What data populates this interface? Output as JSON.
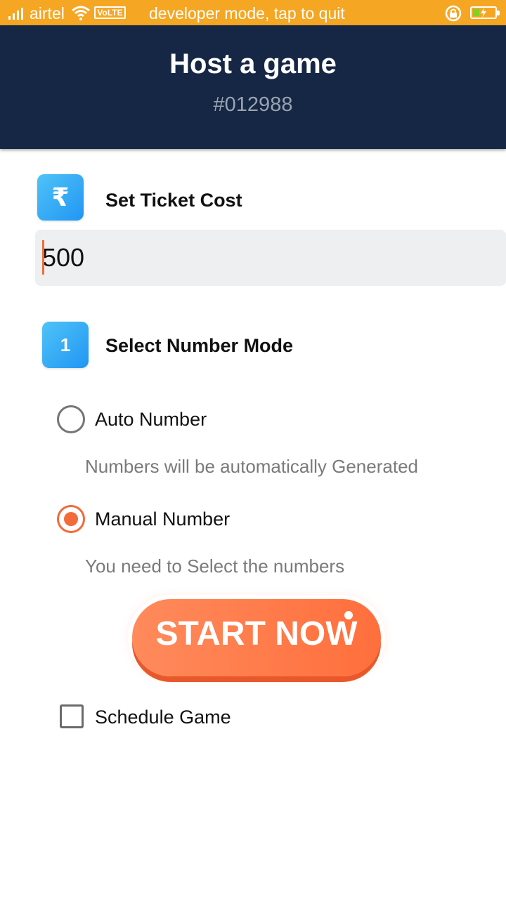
{
  "status_bar": {
    "carrier": "airtel",
    "volte": "VoLTE",
    "message": "developer mode, tap to quit",
    "battery_color": "#7ED321"
  },
  "header": {
    "title": "Host a game",
    "game_id": "#012988",
    "background": "#152744"
  },
  "ticket_cost": {
    "icon": "₹",
    "title": "Set Ticket Cost",
    "value": "500"
  },
  "number_mode": {
    "step": "1",
    "title": "Select Number Mode",
    "options": [
      {
        "label": "Auto Number",
        "description": "Numbers will be automatically Generated",
        "selected": false
      },
      {
        "label": "Manual Number",
        "description": "You need to Select the numbers",
        "selected": true
      }
    ]
  },
  "start_button": {
    "label": "START NOW",
    "color": "#FF7A4A"
  },
  "schedule": {
    "label": "Schedule Game",
    "checked": false
  },
  "colors": {
    "accent": "#F26B3A",
    "tile": "#2196F3",
    "status_bar": "#F5A623"
  }
}
